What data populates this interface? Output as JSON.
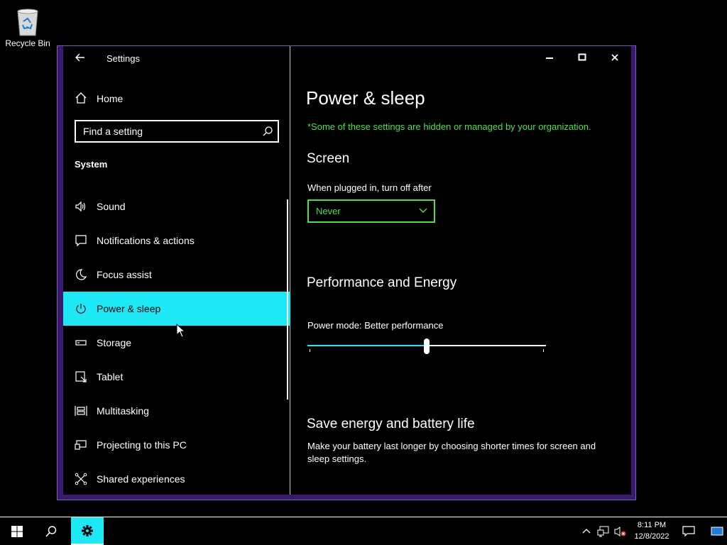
{
  "desktop": {
    "recycle_bin_label": "Recycle Bin"
  },
  "window": {
    "title": "Settings",
    "home_label": "Home",
    "search_placeholder": "Find a setting",
    "section_title": "System",
    "nav_items": [
      {
        "label": "Sound",
        "icon": "speaker-icon"
      },
      {
        "label": "Notifications & actions",
        "icon": "notification-icon"
      },
      {
        "label": "Focus assist",
        "icon": "moon-icon"
      },
      {
        "label": "Power & sleep",
        "icon": "power-icon",
        "active": true
      },
      {
        "label": "Storage",
        "icon": "storage-icon"
      },
      {
        "label": "Tablet",
        "icon": "tablet-icon"
      },
      {
        "label": "Multitasking",
        "icon": "multitasking-icon"
      },
      {
        "label": "Projecting to this PC",
        "icon": "projecting-icon"
      },
      {
        "label": "Shared experiences",
        "icon": "shared-experiences-icon"
      }
    ]
  },
  "content": {
    "page_title": "Power & sleep",
    "org_note": "*Some of these settings are hidden or managed by your organization.",
    "screen_heading": "Screen",
    "plugged_label": "When plugged in, turn off after",
    "plugged_value": "Never",
    "performance_heading": "Performance and Energy",
    "power_mode_label": "Power mode: Better performance",
    "power_mode_slider_fraction": 0.5,
    "save_heading": "Save energy and battery life",
    "save_description": "Make your battery last longer by choosing shorter times for screen and sleep settings."
  },
  "taskbar": {
    "time": "8:11 PM",
    "date": "12/8/2022"
  },
  "colors": {
    "accent": "#1de8f5",
    "managed_green": "#4ddf4d",
    "window_border": "#3a1a6e"
  }
}
